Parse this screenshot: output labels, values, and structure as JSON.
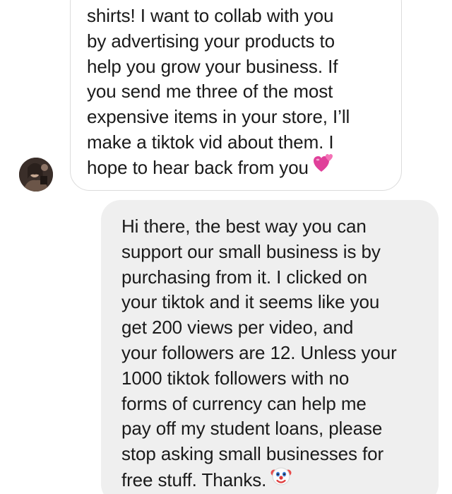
{
  "incoming_message": {
    "lines": [
      "shirts! I want to collab with you",
      "by advertising your products to",
      "help you grow your business. If",
      "you send me three of the most",
      "expensive items in your store, I’ll",
      "make a tiktok vid about them. I",
      "hope to hear back from you"
    ],
    "emoji": "heart-icon",
    "emoji_color": "#e0409a"
  },
  "outgoing_message": {
    "lines": [
      "Hi there, the best way you can",
      "support our small business is by",
      "purchasing from it. I clicked on",
      "your tiktok and it seems like you",
      "get 200 views per video, and",
      "your followers are 12. Unless your",
      "1000 tiktok followers with no",
      "forms of currency can help me",
      "pay off my student loans, please",
      "stop asking small businesses for",
      "free stuff. Thanks."
    ],
    "emoji": "clown-face-icon",
    "bubble_color": "#efefef"
  },
  "colors": {
    "text": "#1a1a1a",
    "incoming_border": "#dcdcdc"
  }
}
